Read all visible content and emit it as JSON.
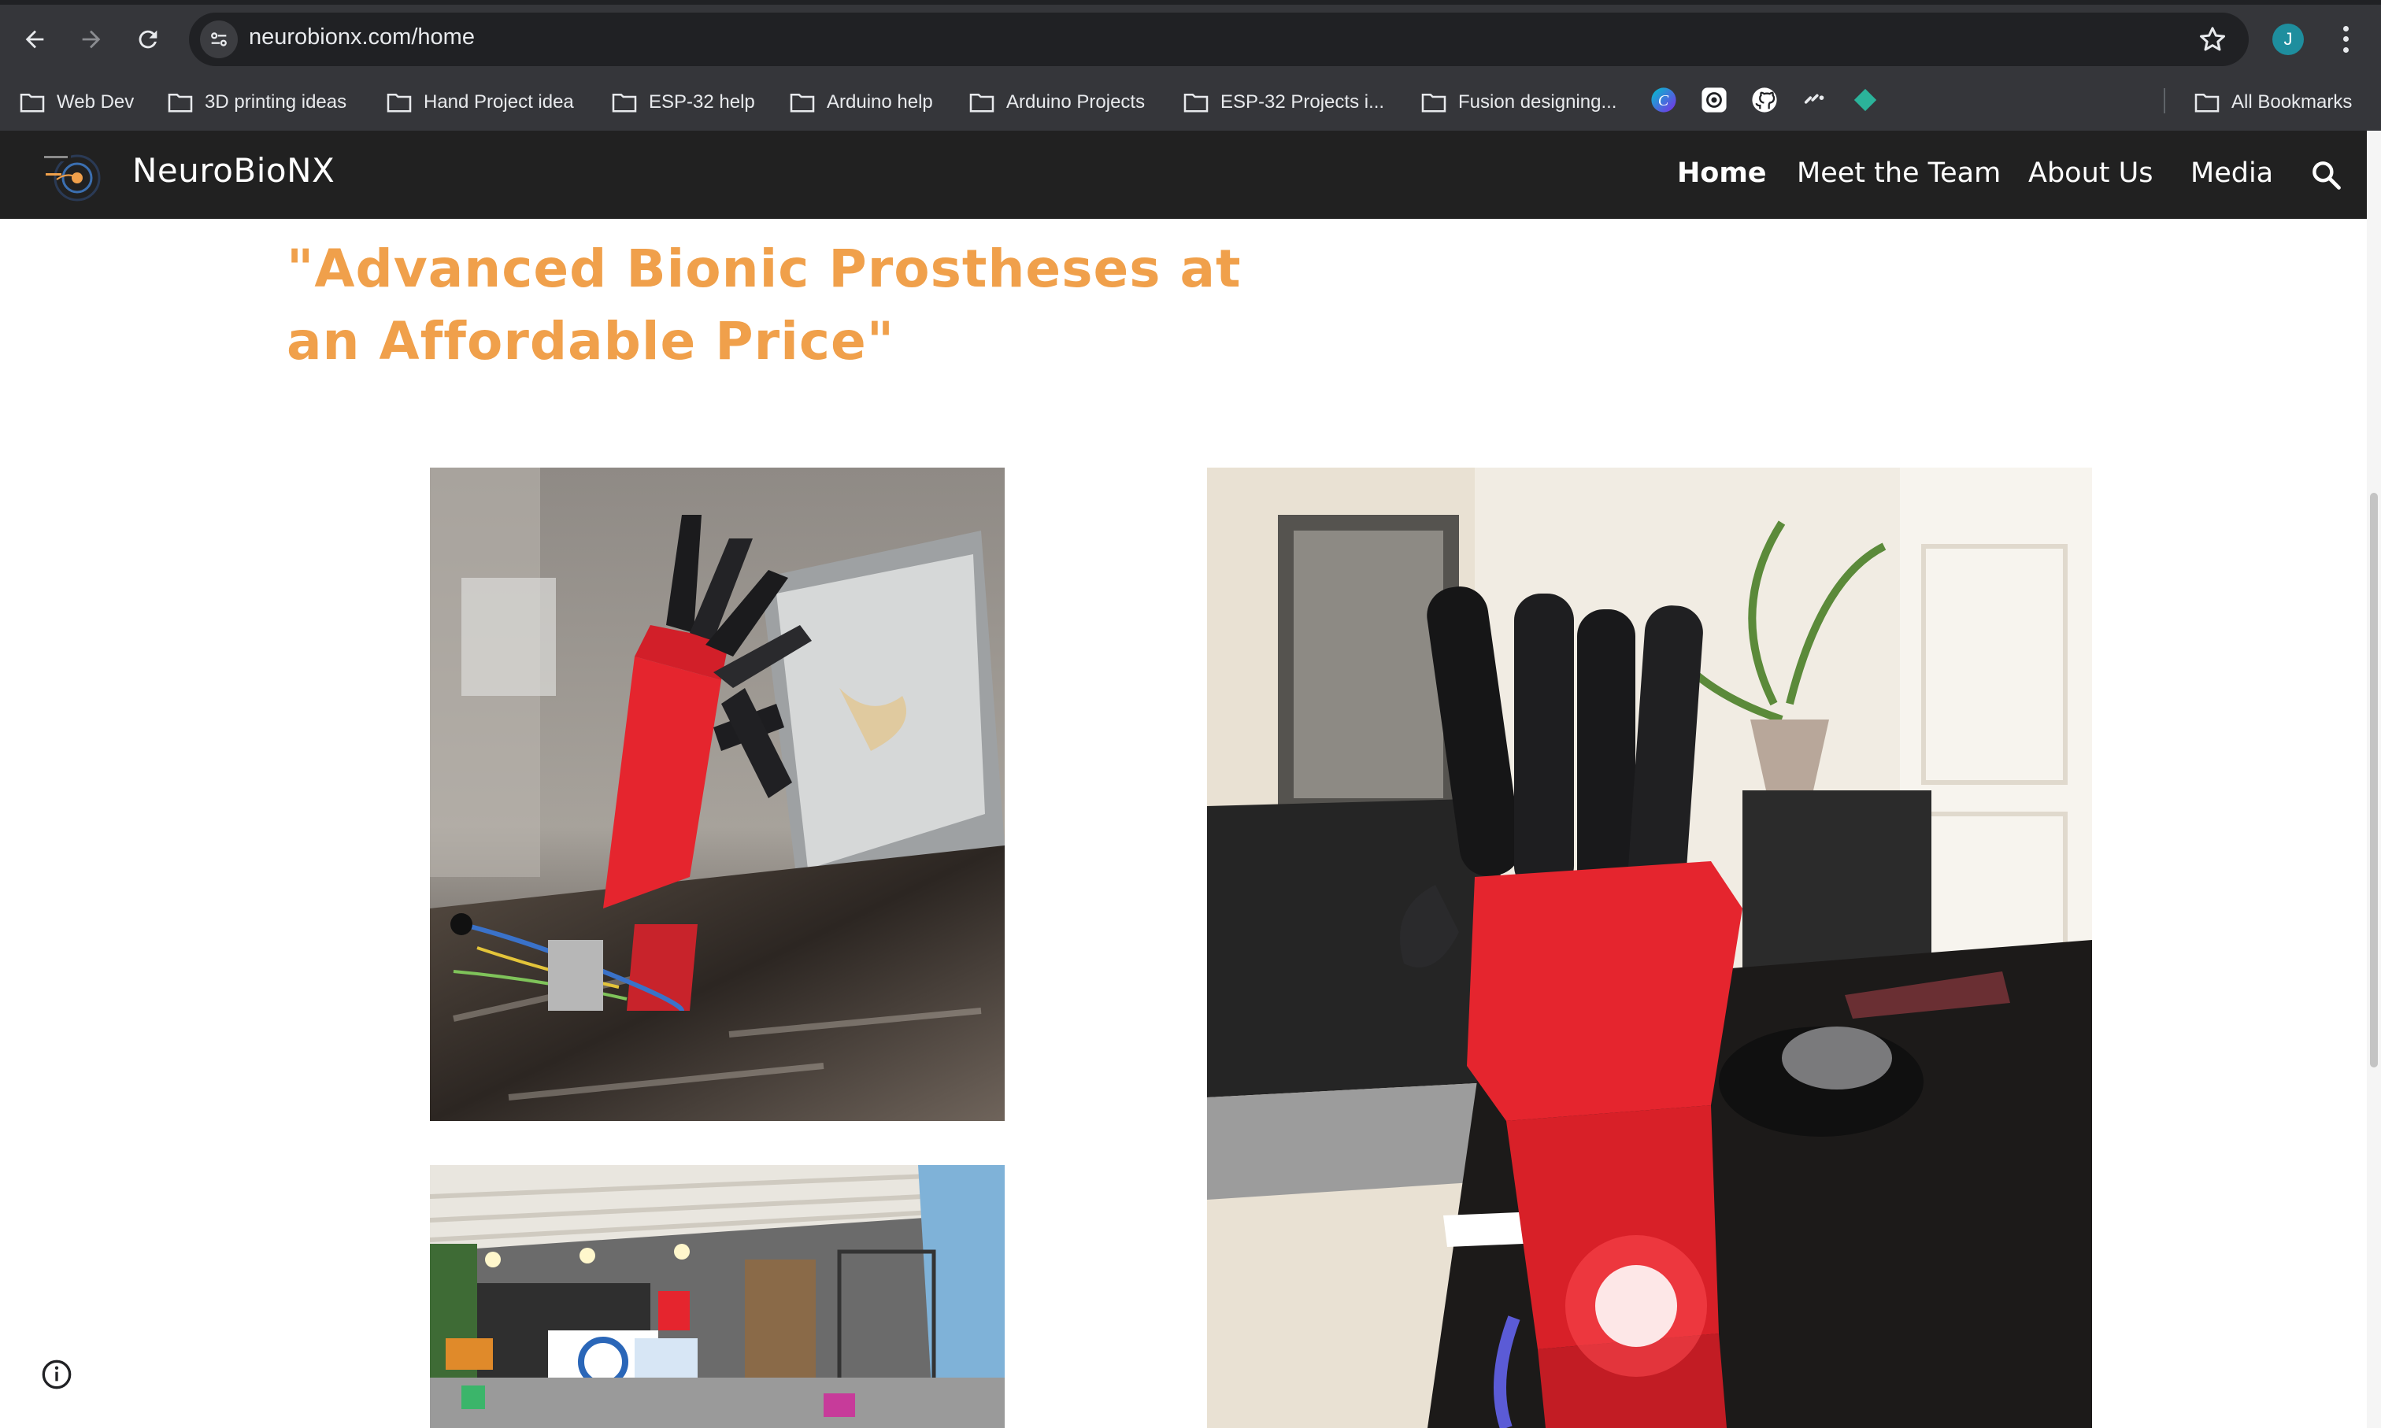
{
  "browser": {
    "url": "neurobionx.com/home",
    "profile_initial": "J",
    "icons": {
      "back": "back-arrow-icon",
      "forward": "forward-arrow-icon",
      "reload": "reload-icon",
      "site_info": "tune-icon",
      "bookmark_star": "star-icon",
      "menu": "kebab-menu-icon"
    }
  },
  "bookmarks": {
    "folders": [
      "Web Dev",
      "3D printing ideas",
      "Hand Project idea",
      "ESP-32 help",
      "Arduino help",
      "Arduino Projects",
      "ESP-32 Projects i...",
      "Fusion designing..."
    ],
    "icon_bookmarks": [
      "canva-icon",
      "openai-icon",
      "github-icon",
      "link-icon",
      "diamond-icon"
    ],
    "all_bookmarks": "All Bookmarks"
  },
  "site": {
    "brand": "NeuroBioNX",
    "nav": [
      "Home",
      "Meet the Team",
      "About Us",
      "Media"
    ],
    "active_nav": "Home",
    "headline": "\"Advanced Bionic Prostheses at an Affordable Price\"",
    "colors": {
      "header_bg": "#212121",
      "headline": "#f0a04b",
      "prosthesis_red": "#e5252e"
    },
    "images": [
      "prosthetic-hand-photo-workbench",
      "prosthetic-hand-photo-desk-lit",
      "workshop-photo"
    ]
  }
}
